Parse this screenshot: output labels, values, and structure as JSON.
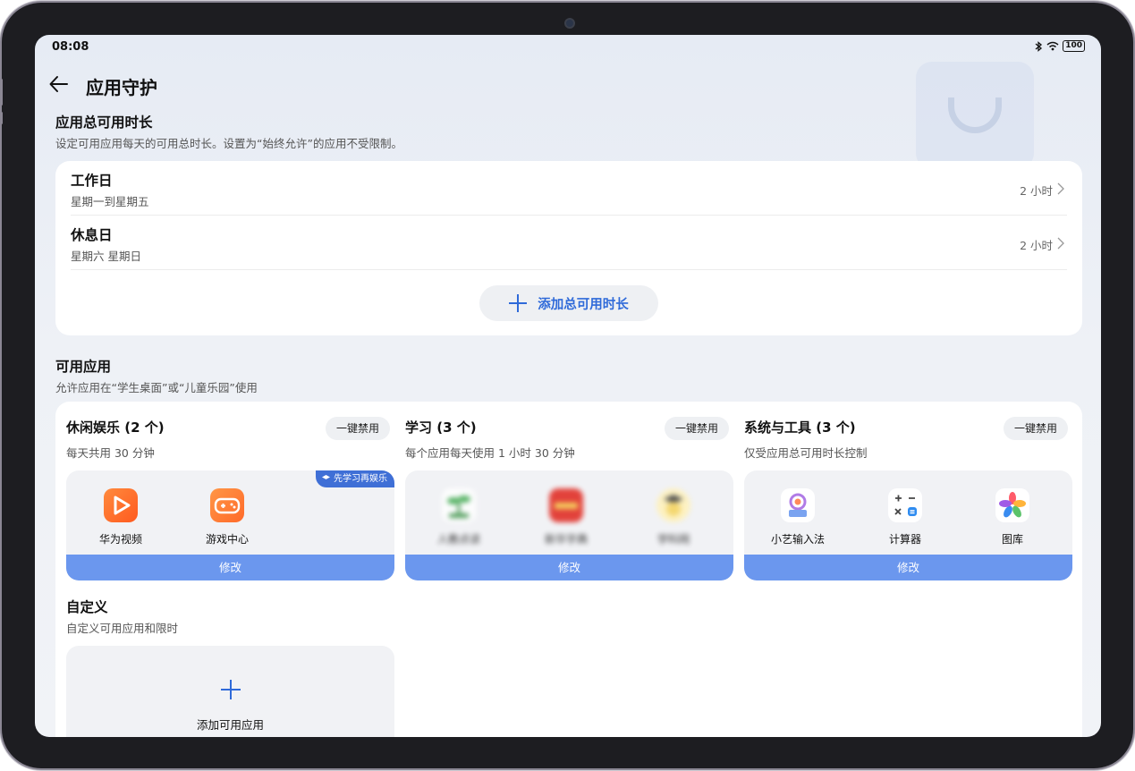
{
  "status": {
    "time": "08:08",
    "battery": "100"
  },
  "header": {
    "title": "应用守护"
  },
  "total_time": {
    "title": "应用总可用时长",
    "subtitle": "设定可用应用每天的可用总时长。设置为“始终允许”的应用不受限制。",
    "rows": [
      {
        "name": "工作日",
        "desc": "星期一到星期五",
        "value": "2 小时"
      },
      {
        "name": "休息日",
        "desc": "星期六 星期日",
        "value": "2 小时"
      }
    ],
    "add_label": "添加总可用时长"
  },
  "available_apps": {
    "title": "可用应用",
    "subtitle": "允许应用在“学生桌面”或“儿童乐园”使用",
    "disable_label": "一键禁用",
    "modify_label": "修改",
    "groups": [
      {
        "title": "休闲娱乐 (2 个)",
        "subtitle": "每天共用 30 分钟",
        "badge": "先学习再娱乐",
        "apps": [
          {
            "name": "华为视频",
            "icon": "video-icon"
          },
          {
            "name": "游戏中心",
            "icon": "gamepad-icon"
          }
        ]
      },
      {
        "title": "学习 (3 个)",
        "subtitle": "每个应用每天使用 1 小时 30 分钟",
        "apps": [
          {
            "name": "人教点读",
            "icon": "sprout-icon"
          },
          {
            "name": "新华字典",
            "icon": "dictionary-icon"
          },
          {
            "name": "学科网",
            "icon": "student-icon"
          }
        ]
      },
      {
        "title": "系统与工具 (3 个)",
        "subtitle": "仅受应用总可用时长控制",
        "apps": [
          {
            "name": "小艺输入法",
            "icon": "keyboard-icon"
          },
          {
            "name": "计算器",
            "icon": "calculator-icon"
          },
          {
            "name": "图库",
            "icon": "gallery-icon"
          }
        ]
      }
    ]
  },
  "custom": {
    "title": "自定义",
    "subtitle": "自定义可用应用和限时",
    "add_label": "添加可用应用"
  },
  "colors": {
    "accent": "#2f6ad9",
    "modify_bar": "#6b97ee",
    "card": "#ffffff"
  }
}
